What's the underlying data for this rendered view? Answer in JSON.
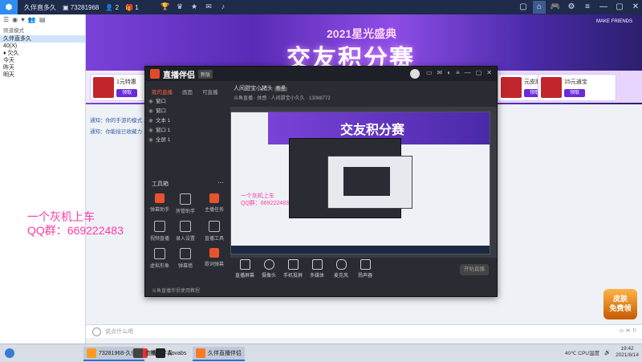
{
  "topbar": {
    "app_title": "久伴直多久",
    "room_id": "73281968",
    "num2": "2",
    "num3": "1",
    "brand_tag": "MAKE FRIENDS"
  },
  "sidebar": {
    "header_label": "频道模式",
    "sub_left": "大 + 1人",
    "sub_right": "将被人员回来领",
    "items": [
      {
        "label": "久伴直多久"
      },
      {
        "label": "40(X)"
      },
      {
        "label": "♦ 欠久"
      },
      {
        "label": "今天"
      },
      {
        "label": "昨天"
      },
      {
        "label": "明天"
      }
    ]
  },
  "banner": {
    "subtitle": "2021星光盛典",
    "title": "交友积分赛"
  },
  "prizes": [
    {
      "title": "1元特惠",
      "btn": "领取"
    },
    {
      "title": "仗奈",
      "btn": "领取"
    },
    {
      "title": "元皮肤",
      "btn": "领取"
    },
    {
      "title": "15元通宝",
      "btn": "领取"
    }
  ],
  "notices": [
    {
      "text": "通知：你的手游的模式 ……"
    },
    {
      "text": "通知：你能接已收藏力"
    }
  ],
  "watermark": {
    "line1": "一个灰机上车",
    "line2": "QQ群：669222483"
  },
  "bottom_badge": {
    "line1": "皮肤",
    "line2": "免费领"
  },
  "chatbar": {
    "placeholder": "说点什么吧"
  },
  "overlay": {
    "app_name": "直播伴侣",
    "version": "新版",
    "tabs": [
      "我的直播",
      "画面",
      "可直播"
    ],
    "room_name": "人间甜宝小猪头",
    "room_badge": "新星",
    "room_meta": "斗鱼直播 · 体感 · 人间甜宝小久久 · 13088772",
    "layers": [
      {
        "label": "窗口",
        "icon": "eye"
      },
      {
        "label": "窗口",
        "icon": "eye"
      },
      {
        "label": "文本 1",
        "icon": "eye"
      },
      {
        "label": "窗口 1",
        "icon": "eye"
      },
      {
        "label": "全屏 1",
        "icon": "eye"
      }
    ],
    "tools_header": "工具箱",
    "tools": [
      {
        "label": "弹幕助手"
      },
      {
        "label": "房管助手"
      },
      {
        "label": "主播任务"
      },
      {
        "label": "视频直播"
      },
      {
        "label": "录入设置"
      },
      {
        "label": "直播工具"
      },
      {
        "label": "虚拟形象"
      },
      {
        "label": "弹幕墙"
      },
      {
        "label": "歌词弹幕"
      }
    ],
    "footer": "斗鱼直播伴侣使用教程",
    "preview_watermark_1": "一个灰机上车",
    "preview_watermark_2": "QQ群：669222483",
    "preview_banner_title": "交友积分赛",
    "bottom_buttons": [
      {
        "label": "直播屏幕"
      },
      {
        "label": "摄像头"
      },
      {
        "label": "手机投屏"
      },
      {
        "label": "多媒体"
      },
      {
        "label": "麦克风"
      },
      {
        "label": "扬声器"
      }
    ],
    "start_button": "开始直播"
  },
  "taskbar": {
    "apps": [
      {
        "label": "73281968-久伴..."
      },
      {
        "label": "播放伴奏"
      },
      {
        "label": "查看"
      },
      {
        "label": "Aovabs"
      },
      {
        "label": "久伴直播伴侣"
      }
    ],
    "temp": "40℃",
    "temp_label": "CPU温度",
    "time": "19:42",
    "date": "2021/8/14"
  }
}
